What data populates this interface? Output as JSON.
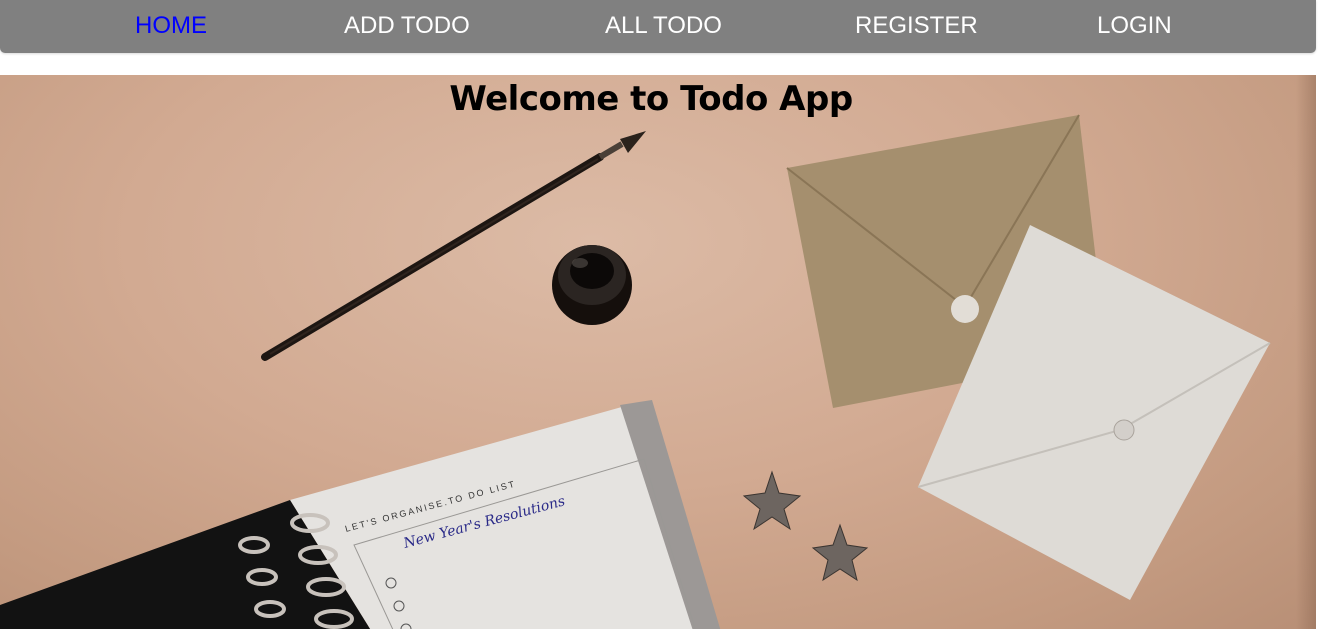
{
  "nav": {
    "items": [
      {
        "label": "HOME",
        "active": true
      },
      {
        "label": "ADD TODO",
        "active": false
      },
      {
        "label": "ALL TODO",
        "active": false
      },
      {
        "label": "REGISTER",
        "active": false
      },
      {
        "label": "LOGIN",
        "active": false
      }
    ],
    "background_color": "#808080",
    "active_color": "#0000ff",
    "text_color": "#ffffff"
  },
  "hero": {
    "title": "Welcome to Todo App",
    "notebook_header": "LET'S ORGANISE.TO DO LIST",
    "notebook_handwriting": "New Year's Resolutions"
  }
}
